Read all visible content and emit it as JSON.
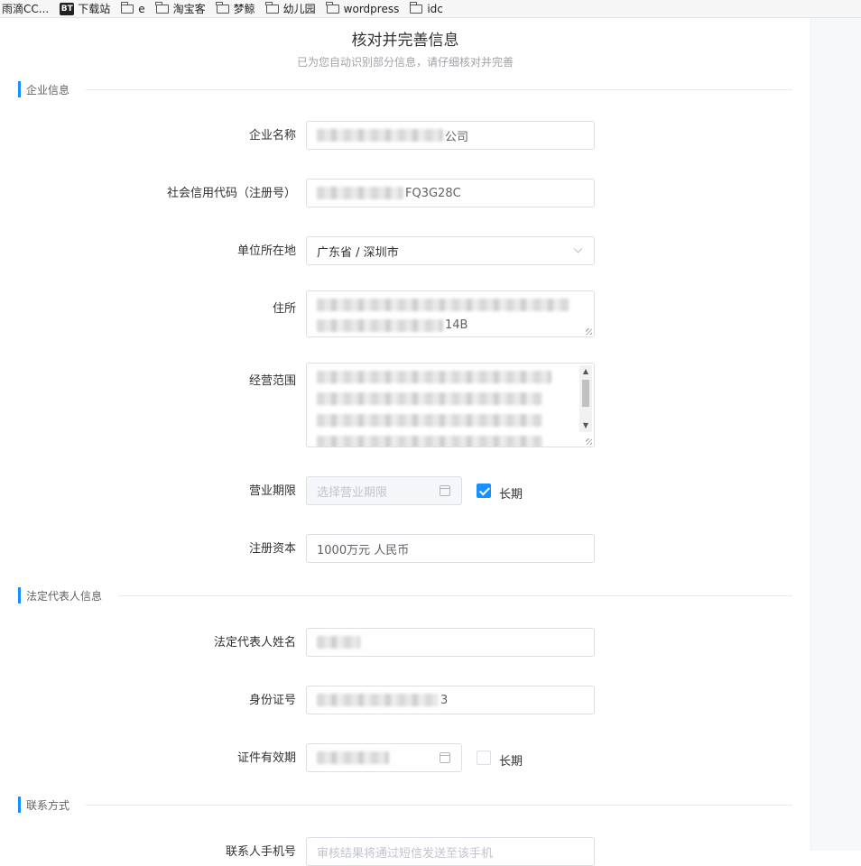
{
  "bookmarks": [
    {
      "label": "雨滴CC...",
      "icon": "raindrop-icon"
    },
    {
      "label": "下载站",
      "icon": "bt-icon",
      "badge": "BT"
    },
    {
      "label": "e",
      "icon": "folder-icon"
    },
    {
      "label": "淘宝客",
      "icon": "folder-icon"
    },
    {
      "label": "梦鲸",
      "icon": "folder-icon"
    },
    {
      "label": "幼儿园",
      "icon": "folder-icon"
    },
    {
      "label": "wordpress",
      "icon": "folder-icon"
    },
    {
      "label": "idc",
      "icon": "folder-icon"
    }
  ],
  "page": {
    "title": "核对并完善信息",
    "subtitle": "已为您自动识别部分信息，请仔细核对并完善"
  },
  "sections": {
    "company": "企业信息",
    "legal_rep": "法定代表人信息",
    "contact": "联系方式"
  },
  "company": {
    "name_label": "企业名称",
    "name_value_visible": "公司",
    "credit_code_label": "社会信用代码（注册号）",
    "credit_code_value_visible": "FQ3G28C",
    "location_label": "单位所在地",
    "location_value": "广东省 / 深圳市",
    "address_label": "住所",
    "address_value_visible": "14B",
    "scope_label": "经营范围",
    "term_label": "营业期限",
    "term_placeholder": "选择营业期限",
    "term_longterm_label": "长期",
    "term_longterm_checked": true,
    "capital_label": "注册资本",
    "capital_value": "1000万元 人民币"
  },
  "legal_rep": {
    "name_label": "法定代表人姓名",
    "id_label": "身份证号",
    "id_value_visible": "3",
    "validity_label": "证件有效期",
    "validity_longterm_label": "长期",
    "validity_longterm_checked": false
  },
  "contact": {
    "phone_label": "联系人手机号",
    "phone_placeholder": "审核结果将通过短信发送至该手机"
  },
  "colors": {
    "accent": "#1890ff",
    "border": "#dcdfe6",
    "placeholder": "#c0c4cc"
  }
}
